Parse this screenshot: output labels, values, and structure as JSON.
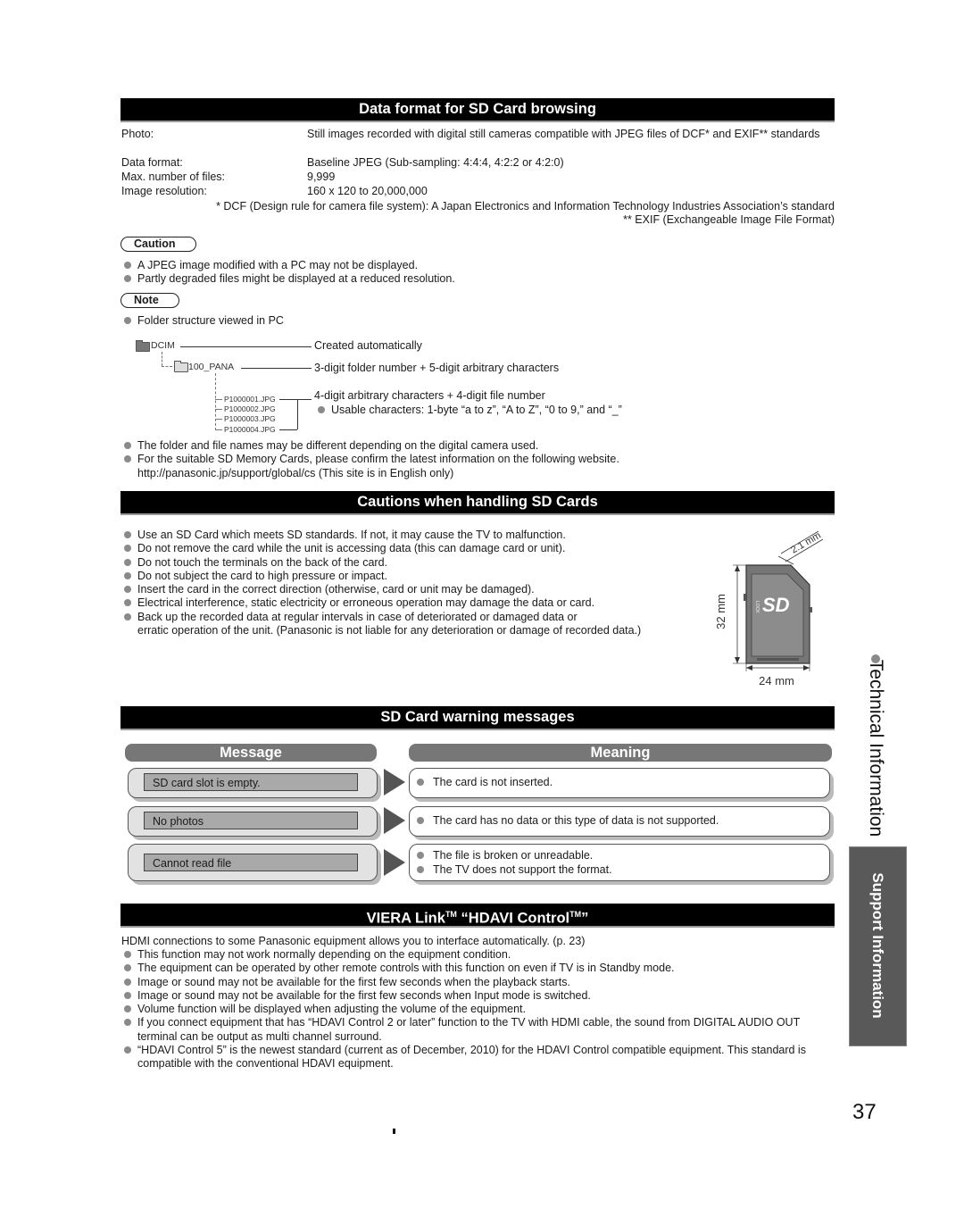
{
  "sections": {
    "data_format": {
      "title": "Data format for SD Card browsing",
      "rows": [
        {
          "label": "Photo:",
          "value": "Still images recorded with digital still cameras compatible with JPEG files of DCF* and EXIF** standards"
        },
        {
          "label": "Data format:",
          "value": "Baseline JPEG (Sub-sampling: 4:4:4, 4:2:2 or 4:2:0)"
        },
        {
          "label": "Max. number of files:",
          "value": "9,999"
        },
        {
          "label": "Image resolution:",
          "value": "160 x 120 to 20,000,000"
        }
      ],
      "footnote_dcf": "* DCF (Design rule for camera file system):  A Japan Electronics and Information Technology Industries Association’s standard",
      "footnote_exif": "** EXIF (Exchangeable Image File Format)",
      "caution_label": "Caution",
      "caution_items": [
        "A JPEG image modified with a PC may not be displayed.",
        "Partly degraded files might be displayed at a reduced resolution."
      ],
      "note_label": "Note",
      "note_items": [
        "Folder structure viewed in PC"
      ],
      "folder_tree": {
        "root": "DCIM",
        "root_desc": "Created automatically",
        "subfolder": "100_PANA",
        "subfolder_desc": "3-digit folder number + 5-digit arbitrary characters",
        "files": [
          "P1000001.JPG",
          "P1000002.JPG",
          "P1000003.JPG",
          "P1000004.JPG"
        ],
        "files_desc": "4-digit arbitrary characters + 4-digit file number",
        "usable_chars": "Usable characters:  1-byte “a to z”, “A to Z”, “0 to 9,” and “_”"
      },
      "after_items": [
        "The folder and file names may be different depending on the digital camera used.",
        "For the suitable SD Memory Cards, please confirm the latest information on the following website."
      ],
      "website_line": "http://panasonic.jp/support/global/cs (This site is in English only)"
    },
    "handling": {
      "title": "Cautions when handling SD Cards",
      "items": [
        "Use an SD Card which meets SD standards. If not, it may cause the TV to malfunction.",
        "Do not remove the card while the unit is accessing data (this can damage card or unit).",
        "Do not touch the terminals on the back of the card.",
        "Do not subject the card to high pressure or impact.",
        "Insert the card in the correct direction (otherwise, card or unit may be damaged).",
        "Electrical interference, static electricity or erroneous operation may damage the data or card.",
        "Back up the recorded data at regular intervals in case of deteriorated or damaged data or"
      ],
      "last_item_cont": "erratic operation of the unit. (Panasonic is not liable for any deterioration or damage of recorded data.)",
      "card_figure": {
        "thickness": "2.1 mm",
        "height": "32 mm",
        "width": "24 mm",
        "logo": "SD",
        "lock_label": "LOCK"
      }
    },
    "warnings": {
      "title": "SD Card warning messages",
      "col_message": "Message",
      "col_meaning": "Meaning",
      "rows": [
        {
          "message": "SD card slot is empty.",
          "meanings": [
            "The card is not inserted."
          ]
        },
        {
          "message": "No photos",
          "meanings": [
            "The card has no data or this type of data is not supported."
          ]
        },
        {
          "message": "Cannot read file",
          "meanings": [
            "The file is broken or unreadable.",
            "The TV does not support the format."
          ]
        }
      ]
    },
    "viera": {
      "title_main": "VIERA Link",
      "title_tm1": "TM",
      "title_mid": " “HDAVI Control",
      "title_tm2": "TM",
      "title_end": "”",
      "intro": "HDMI connections to some Panasonic equipment allows you to interface automatically. (p. 23)",
      "items": [
        "This function may not work normally depending on the equipment condition.",
        "The equipment can be operated by other remote controls with this function on even if TV is in Standby mode.",
        "Image or sound may not be available for the first few seconds when the playback starts.",
        "Image or sound may not be available for the first few seconds when Input mode is switched.",
        "Volume function will be displayed when adjusting the volume of the equipment.",
        "If you connect equipment that has “HDAVI Control 2 or later” function to the TV with HDMI cable, the sound from DIGITAL AUDIO OUT terminal can be output as multi channel surround.",
        "“HDAVI Control 5” is the newest standard (current as of December, 2010) for the HDAVI Control compatible equipment. This standard is compatible with the conventional HDAVI equipment."
      ]
    }
  },
  "side": {
    "technical": "Technical Information",
    "support": "Support Information"
  },
  "page_number": "37"
}
